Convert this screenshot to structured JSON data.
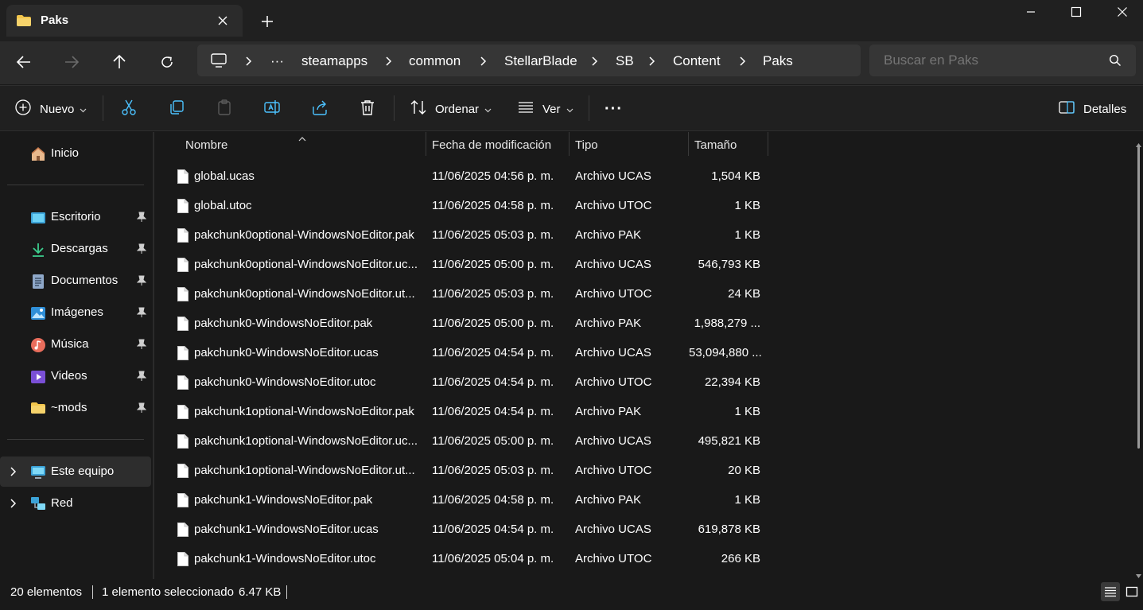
{
  "tab": {
    "title": "Paks"
  },
  "address": {
    "crumbs": [
      "steamapps",
      "common",
      "StellarBlade",
      "SB",
      "Content",
      "Paks"
    ],
    "ellipsis": "···"
  },
  "search": {
    "placeholder": "Buscar en Paks"
  },
  "toolbar": {
    "new_label": "Nuevo",
    "sort_label": "Ordenar",
    "view_label": "Ver",
    "more_label": "···",
    "details_label": "Detalles"
  },
  "sidebar": {
    "home": "Inicio",
    "items": [
      {
        "label": "Escritorio",
        "icon": "desktop-icon"
      },
      {
        "label": "Descargas",
        "icon": "download-icon"
      },
      {
        "label": "Documentos",
        "icon": "document-icon"
      },
      {
        "label": "Imágenes",
        "icon": "pictures-icon"
      },
      {
        "label": "Música",
        "icon": "music-icon"
      },
      {
        "label": "Videos",
        "icon": "videos-icon"
      },
      {
        "label": "~mods",
        "icon": "folder-icon"
      }
    ],
    "this_pc": "Este equipo",
    "network": "Red"
  },
  "columns": {
    "name": "Nombre",
    "date": "Fecha de modificación",
    "type": "Tipo",
    "size": "Tamaño"
  },
  "files": [
    {
      "name": "global.ucas",
      "date": "11/06/2025 04:56 p. m.",
      "type": "Archivo UCAS",
      "size": "1,504 KB"
    },
    {
      "name": "global.utoc",
      "date": "11/06/2025 04:58 p. m.",
      "type": "Archivo UTOC",
      "size": "1 KB"
    },
    {
      "name": "pakchunk0optional-WindowsNoEditor.pak",
      "date": "11/06/2025 05:03 p. m.",
      "type": "Archivo PAK",
      "size": "1 KB"
    },
    {
      "name": "pakchunk0optional-WindowsNoEditor.uc...",
      "date": "11/06/2025 05:00 p. m.",
      "type": "Archivo UCAS",
      "size": "546,793 KB"
    },
    {
      "name": "pakchunk0optional-WindowsNoEditor.ut...",
      "date": "11/06/2025 05:03 p. m.",
      "type": "Archivo UTOC",
      "size": "24 KB"
    },
    {
      "name": "pakchunk0-WindowsNoEditor.pak",
      "date": "11/06/2025 05:00 p. m.",
      "type": "Archivo PAK",
      "size": "1,988,279 ..."
    },
    {
      "name": "pakchunk0-WindowsNoEditor.ucas",
      "date": "11/06/2025 04:54 p. m.",
      "type": "Archivo UCAS",
      "size": "53,094,880 ..."
    },
    {
      "name": "pakchunk0-WindowsNoEditor.utoc",
      "date": "11/06/2025 04:54 p. m.",
      "type": "Archivo UTOC",
      "size": "22,394 KB"
    },
    {
      "name": "pakchunk1optional-WindowsNoEditor.pak",
      "date": "11/06/2025 04:54 p. m.",
      "type": "Archivo PAK",
      "size": "1 KB"
    },
    {
      "name": "pakchunk1optional-WindowsNoEditor.uc...",
      "date": "11/06/2025 05:00 p. m.",
      "type": "Archivo UCAS",
      "size": "495,821 KB"
    },
    {
      "name": "pakchunk1optional-WindowsNoEditor.ut...",
      "date": "11/06/2025 05:03 p. m.",
      "type": "Archivo UTOC",
      "size": "20 KB"
    },
    {
      "name": "pakchunk1-WindowsNoEditor.pak",
      "date": "11/06/2025 04:58 p. m.",
      "type": "Archivo PAK",
      "size": "1 KB"
    },
    {
      "name": "pakchunk1-WindowsNoEditor.ucas",
      "date": "11/06/2025 04:54 p. m.",
      "type": "Archivo UCAS",
      "size": "619,878 KB"
    },
    {
      "name": "pakchunk1-WindowsNoEditor.utoc",
      "date": "11/06/2025 05:04 p. m.",
      "type": "Archivo UTOC",
      "size": "266 KB"
    }
  ],
  "status": {
    "count": "20 elementos",
    "selected": "1 elemento seleccionado",
    "size": "6.47 KB"
  },
  "colors": {
    "folder": "#f2c54b",
    "accent": "#4cc2ff",
    "background": "#191919"
  }
}
